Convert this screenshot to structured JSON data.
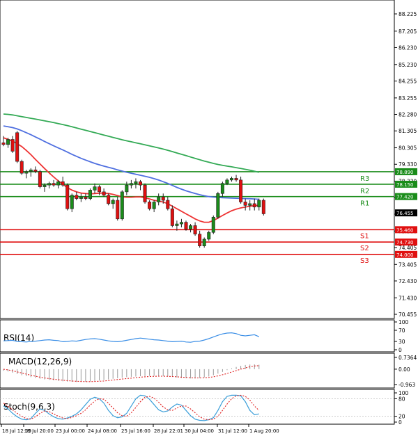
{
  "chart_data": [
    {
      "type": "candlestick",
      "panel": "main",
      "y_ticks": [
        "88.225",
        "87.205",
        "86.230",
        "85.230",
        "84.255",
        "83.255",
        "82.280",
        "81.305",
        "80.305",
        "79.330",
        "78.330",
        "77.355",
        "76.380",
        "75.380",
        "74.405",
        "73.405",
        "72.430",
        "71.430",
        "70.455"
      ],
      "ylim": [
        70.455,
        88.225
      ],
      "x_ticks": [
        "18 Jul 12:00",
        "19 Jul 20:00",
        "23 Jul 00:00",
        "24 Jul 08:00",
        "25 Jul 16:00",
        "28 Jul 22:01",
        "30 Jul 04:00",
        "31 Jul 12:00",
        "1 Aug 20:00"
      ],
      "last_price": {
        "value": 76.455,
        "label": "76.455"
      },
      "levels": [
        {
          "name": "R3",
          "value": 78.89,
          "label": "78.890",
          "color": "#1a8c1a"
        },
        {
          "name": "R2",
          "value": 78.15,
          "label": "78.150",
          "color": "#1a8c1a"
        },
        {
          "name": "R1",
          "value": 77.42,
          "label": "77.420",
          "color": "#1a8c1a"
        },
        {
          "name": "S1",
          "value": 75.46,
          "label": "75.460",
          "color": "#e01010"
        },
        {
          "name": "S2",
          "value": 74.73,
          "label": "74.730",
          "color": "#e01010"
        },
        {
          "name": "S3",
          "value": 74.0,
          "label": "74.000",
          "color": "#e01010"
        }
      ],
      "candles": [
        {
          "o": 80.6,
          "h": 81.0,
          "l": 80.4,
          "c": 80.5
        },
        {
          "o": 80.5,
          "h": 80.9,
          "l": 80.3,
          "c": 80.8
        },
        {
          "o": 80.8,
          "h": 81.0,
          "l": 80.0,
          "c": 80.1
        },
        {
          "o": 81.2,
          "h": 81.3,
          "l": 79.4,
          "c": 79.5
        },
        {
          "o": 79.5,
          "h": 79.6,
          "l": 78.7,
          "c": 78.8
        },
        {
          "o": 78.8,
          "h": 79.0,
          "l": 78.5,
          "c": 78.9
        },
        {
          "o": 78.9,
          "h": 79.1,
          "l": 78.6,
          "c": 79.0
        },
        {
          "o": 79.0,
          "h": 79.2,
          "l": 78.8,
          "c": 78.9
        },
        {
          "o": 78.9,
          "h": 79.0,
          "l": 77.9,
          "c": 78.0
        },
        {
          "o": 78.0,
          "h": 78.2,
          "l": 77.7,
          "c": 78.1
        },
        {
          "o": 78.1,
          "h": 78.3,
          "l": 77.9,
          "c": 78.2
        },
        {
          "o": 78.2,
          "h": 78.4,
          "l": 78.0,
          "c": 78.1
        },
        {
          "o": 78.1,
          "h": 78.4,
          "l": 77.9,
          "c": 78.3
        },
        {
          "o": 78.3,
          "h": 78.6,
          "l": 78.0,
          "c": 78.1
        },
        {
          "o": 78.1,
          "h": 78.2,
          "l": 76.6,
          "c": 76.7
        },
        {
          "o": 76.7,
          "h": 77.6,
          "l": 76.5,
          "c": 77.5
        },
        {
          "o": 77.5,
          "h": 77.7,
          "l": 77.2,
          "c": 77.3
        },
        {
          "o": 77.3,
          "h": 77.6,
          "l": 77.1,
          "c": 77.4
        },
        {
          "o": 77.4,
          "h": 77.6,
          "l": 77.2,
          "c": 77.3
        },
        {
          "o": 77.3,
          "h": 77.9,
          "l": 77.2,
          "c": 77.8
        },
        {
          "o": 77.8,
          "h": 78.2,
          "l": 77.6,
          "c": 78.0
        },
        {
          "o": 78.0,
          "h": 78.1,
          "l": 77.5,
          "c": 77.7
        },
        {
          "o": 77.7,
          "h": 77.9,
          "l": 77.4,
          "c": 77.5
        },
        {
          "o": 77.5,
          "h": 77.6,
          "l": 76.9,
          "c": 77.0
        },
        {
          "o": 77.0,
          "h": 77.3,
          "l": 76.7,
          "c": 77.2
        },
        {
          "o": 77.2,
          "h": 77.4,
          "l": 76.0,
          "c": 76.1
        },
        {
          "o": 76.1,
          "h": 77.8,
          "l": 76.0,
          "c": 77.7
        },
        {
          "o": 77.7,
          "h": 78.3,
          "l": 77.5,
          "c": 78.1
        },
        {
          "o": 78.1,
          "h": 78.4,
          "l": 77.9,
          "c": 78.2
        },
        {
          "o": 78.2,
          "h": 78.5,
          "l": 77.9,
          "c": 78.3
        },
        {
          "o": 78.3,
          "h": 78.4,
          "l": 77.8,
          "c": 78.1
        },
        {
          "o": 78.1,
          "h": 78.2,
          "l": 77.0,
          "c": 77.1
        },
        {
          "o": 77.1,
          "h": 77.2,
          "l": 76.6,
          "c": 76.7
        },
        {
          "o": 76.7,
          "h": 77.2,
          "l": 76.5,
          "c": 77.1
        },
        {
          "o": 77.1,
          "h": 77.6,
          "l": 76.9,
          "c": 77.4
        },
        {
          "o": 77.4,
          "h": 77.6,
          "l": 77.0,
          "c": 77.2
        },
        {
          "o": 77.2,
          "h": 77.4,
          "l": 76.6,
          "c": 76.7
        },
        {
          "o": 76.7,
          "h": 76.9,
          "l": 75.6,
          "c": 75.7
        },
        {
          "o": 75.7,
          "h": 76.0,
          "l": 75.4,
          "c": 75.8
        },
        {
          "o": 75.8,
          "h": 76.1,
          "l": 75.6,
          "c": 75.9
        },
        {
          "o": 75.9,
          "h": 76.0,
          "l": 75.4,
          "c": 75.5
        },
        {
          "o": 75.5,
          "h": 75.8,
          "l": 75.3,
          "c": 75.7
        },
        {
          "o": 75.7,
          "h": 75.9,
          "l": 75.1,
          "c": 75.2
        },
        {
          "o": 75.2,
          "h": 75.4,
          "l": 74.4,
          "c": 74.5
        },
        {
          "o": 74.5,
          "h": 75.0,
          "l": 74.4,
          "c": 74.9
        },
        {
          "o": 74.9,
          "h": 75.4,
          "l": 74.8,
          "c": 75.3
        },
        {
          "o": 75.3,
          "h": 76.3,
          "l": 75.2,
          "c": 76.2
        },
        {
          "o": 76.2,
          "h": 77.7,
          "l": 76.1,
          "c": 77.6
        },
        {
          "o": 77.6,
          "h": 78.3,
          "l": 77.4,
          "c": 78.2
        },
        {
          "o": 78.2,
          "h": 78.5,
          "l": 78.1,
          "c": 78.4
        },
        {
          "o": 78.4,
          "h": 78.6,
          "l": 78.3,
          "c": 78.5
        },
        {
          "o": 78.5,
          "h": 78.7,
          "l": 78.3,
          "c": 78.4
        },
        {
          "o": 78.4,
          "h": 78.6,
          "l": 77.0,
          "c": 77.1
        },
        {
          "o": 77.1,
          "h": 77.3,
          "l": 76.6,
          "c": 76.9
        },
        {
          "o": 76.9,
          "h": 77.2,
          "l": 76.6,
          "c": 77.0
        },
        {
          "o": 77.0,
          "h": 77.3,
          "l": 76.6,
          "c": 76.8
        },
        {
          "o": 76.8,
          "h": 77.3,
          "l": 76.6,
          "c": 77.2
        },
        {
          "o": 77.2,
          "h": 77.3,
          "l": 76.3,
          "c": 76.4
        }
      ],
      "ma_slow": [
        82.3,
        82.28,
        82.25,
        82.2,
        82.15,
        82.1,
        82.05,
        82.0,
        81.95,
        81.9,
        81.85,
        81.8,
        81.74,
        81.68,
        81.62,
        81.55,
        81.48,
        81.41,
        81.34,
        81.27,
        81.2,
        81.13,
        81.06,
        80.99,
        80.92,
        80.85,
        80.78,
        80.72,
        80.66,
        80.6,
        80.54,
        80.48,
        80.42,
        80.36,
        80.3,
        80.23,
        80.16,
        80.08,
        80.0,
        79.92,
        79.84,
        79.76,
        79.68,
        79.6,
        79.52,
        79.45,
        79.38,
        79.32,
        79.27,
        79.22,
        79.18,
        79.13,
        79.08,
        79.03,
        78.98,
        78.92,
        78.86
      ],
      "ma_mid": [
        81.6,
        81.55,
        81.5,
        81.42,
        81.32,
        81.2,
        81.08,
        80.95,
        80.82,
        80.68,
        80.55,
        80.42,
        80.3,
        80.18,
        80.05,
        79.92,
        79.8,
        79.68,
        79.58,
        79.48,
        79.38,
        79.3,
        79.22,
        79.15,
        79.08,
        79.0,
        78.93,
        78.86,
        78.8,
        78.74,
        78.68,
        78.62,
        78.56,
        78.48,
        78.4,
        78.3,
        78.2,
        78.08,
        77.96,
        77.86,
        77.76,
        77.68,
        77.6,
        77.53,
        77.47,
        77.42,
        77.39,
        77.37,
        77.35,
        77.34,
        77.33,
        77.32,
        77.31,
        77.3,
        77.29,
        77.28,
        77.26
      ],
      "ma_fast": [
        80.9,
        80.8,
        80.7,
        80.55,
        80.38,
        80.15,
        79.9,
        79.62,
        79.35,
        79.08,
        78.82,
        78.58,
        78.35,
        78.15,
        77.95,
        77.8,
        77.7,
        77.63,
        77.6,
        77.58,
        77.6,
        77.62,
        77.63,
        77.6,
        77.55,
        77.48,
        77.4,
        77.38,
        77.38,
        77.4,
        77.4,
        77.35,
        77.28,
        77.2,
        77.15,
        77.1,
        77.0,
        76.85,
        76.7,
        76.55,
        76.4,
        76.25,
        76.1,
        75.98,
        75.9,
        75.9,
        76.0,
        76.15,
        76.3,
        76.45,
        76.58,
        76.68,
        76.75,
        76.8,
        76.85,
        76.88,
        76.9
      ]
    },
    {
      "type": "line",
      "panel": "rsi",
      "title": "RSI(14)",
      "y_ticks": [
        "100",
        "70",
        "30",
        "0"
      ],
      "ylim": [
        0,
        100
      ],
      "series": [
        {
          "values": [
            32,
            33,
            34,
            30,
            29,
            28,
            30,
            31,
            33,
            35,
            36,
            34,
            33,
            29,
            30,
            32,
            31,
            34,
            37,
            39,
            40,
            38,
            35,
            32,
            30,
            29,
            31,
            34,
            37,
            40,
            42,
            40,
            38,
            36,
            35,
            33,
            31,
            29,
            30,
            31,
            28,
            27,
            30,
            31,
            35,
            40,
            46,
            52,
            57,
            60,
            61,
            58,
            52,
            50,
            52,
            54,
            47
          ]
        }
      ]
    },
    {
      "type": "bar",
      "panel": "macd",
      "title": "MACD(12,26,9)",
      "y_ticks": [
        "0.7364",
        "0.00",
        "-0.963"
      ],
      "ylim": [
        -0.963,
        0.7364
      ],
      "histogram": [
        -0.1,
        -0.15,
        -0.22,
        -0.3,
        -0.38,
        -0.44,
        -0.5,
        -0.55,
        -0.6,
        -0.64,
        -0.67,
        -0.7,
        -0.73,
        -0.76,
        -0.78,
        -0.79,
        -0.8,
        -0.8,
        -0.79,
        -0.77,
        -0.74,
        -0.71,
        -0.68,
        -0.64,
        -0.6,
        -0.57,
        -0.53,
        -0.5,
        -0.48,
        -0.46,
        -0.44,
        -0.43,
        -0.42,
        -0.42,
        -0.43,
        -0.44,
        -0.46,
        -0.49,
        -0.52,
        -0.55,
        -0.57,
        -0.58,
        -0.58,
        -0.56,
        -0.52,
        -0.46,
        -0.38,
        -0.28,
        -0.17,
        -0.06,
        0.05,
        0.14,
        0.21,
        0.26,
        0.29,
        0.3,
        0.28
      ],
      "signal": [
        0.0,
        -0.05,
        -0.1,
        -0.17,
        -0.24,
        -0.31,
        -0.38,
        -0.44,
        -0.5,
        -0.55,
        -0.59,
        -0.63,
        -0.66,
        -0.69,
        -0.72,
        -0.74,
        -0.76,
        -0.77,
        -0.78,
        -0.78,
        -0.77,
        -0.76,
        -0.74,
        -0.71,
        -0.68,
        -0.65,
        -0.62,
        -0.59,
        -0.56,
        -0.53,
        -0.5,
        -0.48,
        -0.46,
        -0.45,
        -0.44,
        -0.44,
        -0.45,
        -0.46,
        -0.48,
        -0.5,
        -0.52,
        -0.54,
        -0.55,
        -0.55,
        -0.54,
        -0.52,
        -0.48,
        -0.42,
        -0.35,
        -0.27,
        -0.18,
        -0.09,
        0.0,
        0.08,
        0.15,
        0.2,
        0.22
      ]
    },
    {
      "type": "line",
      "panel": "stoch",
      "title": "Stoch(9,6,3)",
      "y_ticks": [
        "100",
        "80",
        "20",
        "0"
      ],
      "ylim": [
        0,
        100
      ],
      "series": [
        {
          "values": [
            55,
            45,
            30,
            18,
            10,
            8,
            12,
            30,
            45,
            40,
            28,
            18,
            12,
            10,
            14,
            20,
            28,
            42,
            60,
            78,
            85,
            80,
            65,
            40,
            22,
            15,
            18,
            30,
            55,
            80,
            92,
            90,
            78,
            60,
            42,
            35,
            38,
            52,
            62,
            58,
            40,
            22,
            10,
            6,
            5,
            8,
            15,
            40,
            70,
            88,
            92,
            92,
            90,
            70,
            40,
            25,
            28
          ]
        },
        {
          "values": [
            65,
            55,
            42,
            30,
            20,
            12,
            10,
            18,
            30,
            38,
            36,
            28,
            20,
            14,
            12,
            16,
            22,
            30,
            42,
            58,
            72,
            80,
            78,
            65,
            48,
            32,
            22,
            20,
            32,
            50,
            70,
            85,
            88,
            82,
            68,
            52,
            42,
            40,
            48,
            55,
            55,
            45,
            32,
            18,
            10,
            8,
            10,
            20,
            40,
            62,
            80,
            90,
            92,
            88,
            75,
            55,
            40
          ]
        }
      ]
    }
  ],
  "colors": {
    "up": "#1a8c1a",
    "down": "#e01010",
    "ma_slow": "#33aa55",
    "ma_mid": "#4f6fe0",
    "ma_fast": "#ee3333",
    "rsi": "#3a8ee6",
    "macd_signal": "#e02020",
    "stoch_main": "#3a9ed9",
    "stoch_signal": "#e02020",
    "grid": "#e6e6e6",
    "axis": "#000000"
  }
}
